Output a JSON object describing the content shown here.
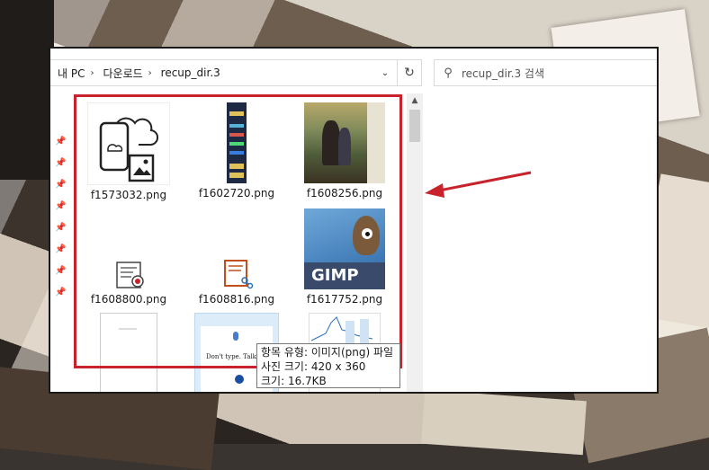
{
  "address": {
    "crumbs": [
      "내 PC",
      "다운로드",
      "recup_dir.3"
    ]
  },
  "search": {
    "placeholder": "recup_dir.3 검색"
  },
  "files": [
    {
      "name": "f1573032.png",
      "icon": "cloud-phone-image-icon"
    },
    {
      "name": "f1602720.png",
      "icon": "vertical-banner-icon"
    },
    {
      "name": "f1608256.png",
      "icon": "painting-thumbnail-icon"
    },
    {
      "name": "f1608800.png",
      "icon": "document-settings-icon"
    },
    {
      "name": "f1608816.png",
      "icon": "document-share-icon"
    },
    {
      "name": "f1617752.png",
      "icon": "gimp-logo-icon"
    }
  ],
  "gimp_text": "GIMP",
  "partial_row": {
    "doc_snippet": "Don't type. Talk|"
  },
  "tooltip": {
    "type_line": "항목 유형: 이미지(png) 파일",
    "size_line": "사진 크기: 420 x 360",
    "filesize_line": "크기: 16.7KB"
  },
  "colors": {
    "annotation_red": "#c8232c"
  }
}
